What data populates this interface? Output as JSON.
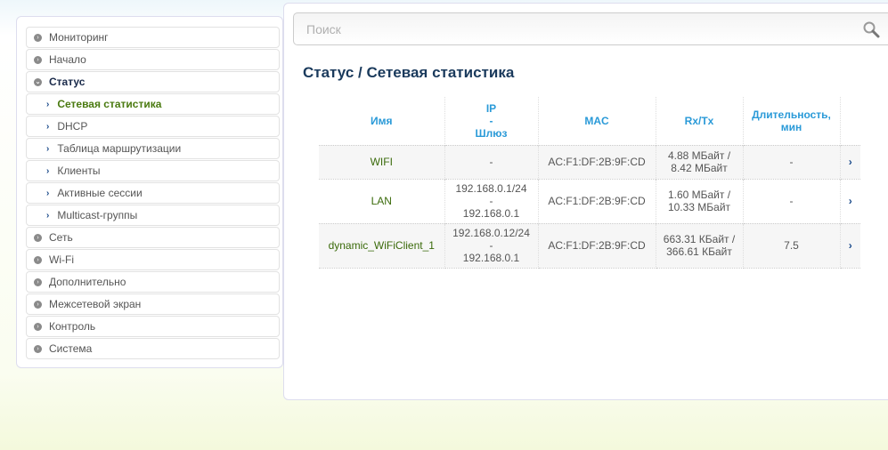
{
  "sidebar": {
    "items": [
      {
        "label": "Мониторинг",
        "type": "top"
      },
      {
        "label": "Начало",
        "type": "top"
      },
      {
        "label": "Статус",
        "type": "open"
      },
      {
        "label": "Сетевая статистика",
        "type": "active"
      },
      {
        "label": "DHCP",
        "type": "sub"
      },
      {
        "label": "Таблица маршрутизации",
        "type": "sub"
      },
      {
        "label": "Клиенты",
        "type": "sub"
      },
      {
        "label": "Активные сессии",
        "type": "sub"
      },
      {
        "label": "Multicast-группы",
        "type": "sub"
      },
      {
        "label": "Сеть",
        "type": "top"
      },
      {
        "label": "Wi-Fi",
        "type": "top"
      },
      {
        "label": "Дополнительно",
        "type": "top"
      },
      {
        "label": "Межсетевой экран",
        "type": "top"
      },
      {
        "label": "Контроль",
        "type": "top"
      },
      {
        "label": "Система",
        "type": "top"
      }
    ]
  },
  "search": {
    "placeholder": "Поиск",
    "value": ""
  },
  "page": {
    "title": "Статус /  Сетевая статистика"
  },
  "table": {
    "headers": {
      "name": "Имя",
      "ip": "IP",
      "ip_sep": "-",
      "gw": "Шлюз",
      "mac": "MAC",
      "rxtx": "Rx/Tx",
      "dur1": "Длительность,",
      "dur2": "мин"
    },
    "rows": [
      {
        "name": "WIFI",
        "ip": "-",
        "sep": "",
        "gw": "",
        "mac": "AC:F1:DF:2B:9F:CD",
        "rx": "4.88 МБайт /",
        "tx": "8.42 МБайт",
        "dur": "-"
      },
      {
        "name": "LAN",
        "ip": "192.168.0.1/24",
        "sep": "-",
        "gw": "192.168.0.1",
        "mac": "AC:F1:DF:2B:9F:CD",
        "rx": "1.60 МБайт /",
        "tx": "10.33 МБайт",
        "dur": "-"
      },
      {
        "name": "dynamic_WiFiClient_1",
        "ip": "192.168.0.12/24",
        "sep": "-",
        "gw": "192.168.0.1",
        "mac": "AC:F1:DF:2B:9F:CD",
        "rx": "663.31 КБайт /",
        "tx": "366.61 КБайт",
        "dur": "7.5"
      }
    ]
  }
}
